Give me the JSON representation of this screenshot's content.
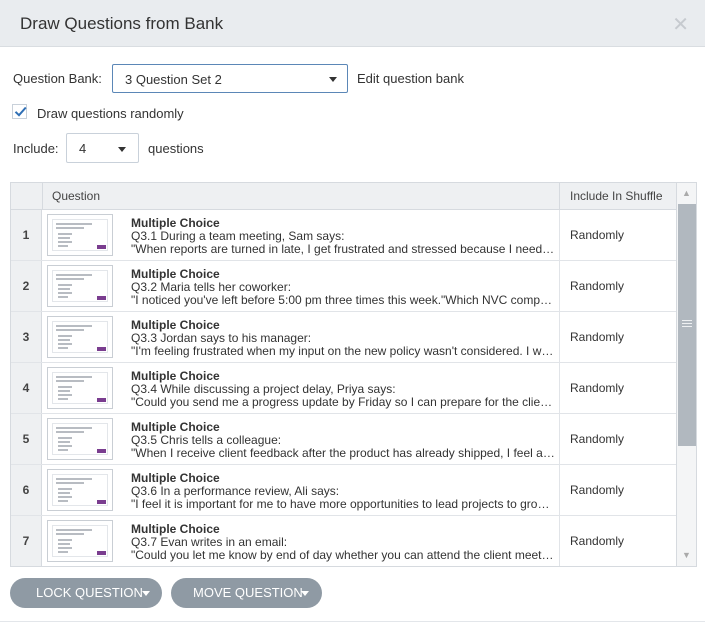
{
  "dialog": {
    "title": "Draw Questions from Bank",
    "close_icon": "close-icon"
  },
  "question_bank": {
    "label": "Question Bank:",
    "selected": "3 Question Set 2",
    "edit_link": "Edit question bank"
  },
  "draw_randomly": {
    "label": "Draw questions randomly",
    "checked": true
  },
  "include": {
    "label": "Include:",
    "value": "4",
    "suffix": "questions"
  },
  "table": {
    "headers": {
      "question": "Question",
      "include_in_shuffle": "Include In Shuffle"
    },
    "rows": [
      {
        "num": "1",
        "type": "Multiple Choice",
        "title": "Q3.1 During a team meeting, Sam says:",
        "snippet": "\"When reports are turned in late, I get frustrated and stressed because I need time to review them thoroughly.\"",
        "shuffle": "Randomly"
      },
      {
        "num": "2",
        "type": "Multiple Choice",
        "title": "Q3.2 Maria tells her coworker:",
        "snippet": "\"I noticed you've left before 5:00 pm three times this week.\"Which NVC component is this?",
        "shuffle": "Randomly"
      },
      {
        "num": "3",
        "type": "Multiple Choice",
        "title": "Q3.3 Jordan says to his manager:",
        "snippet": "\"I'm feeling frustrated when my input on the new policy wasn't considered. I want to be included.\"",
        "shuffle": "Randomly"
      },
      {
        "num": "4",
        "type": "Multiple Choice",
        "title": "Q3.4 While discussing a project delay, Priya says:",
        "snippet": "\"Could you send me a progress update by Friday so I can prepare for the client meeting?\"",
        "shuffle": "Randomly"
      },
      {
        "num": "5",
        "type": "Multiple Choice",
        "title": "Q3.5 Chris tells a colleague:",
        "snippet": "\"When I receive client feedback after the product has already shipped, I feel anxious about it.\"",
        "shuffle": "Randomly"
      },
      {
        "num": "6",
        "type": "Multiple Choice",
        "title": "Q3.6 In a performance review, Ali says:",
        "snippet": "\"I feel it is important for me to have more opportunities to lead projects to grow in my role.\"",
        "shuffle": "Randomly"
      },
      {
        "num": "7",
        "type": "Multiple Choice",
        "title": "Q3.7 Evan writes in an email:",
        "snippet": "\"Could you let me know by end of day whether you can attend the client meeting?\"",
        "shuffle": "Randomly"
      }
    ]
  },
  "scrollbar": {
    "up_icon": "scroll-up-icon",
    "down_icon": "scroll-down-icon"
  },
  "actions": {
    "lock": "LOCK QUESTION",
    "move": "MOVE QUESTION"
  },
  "colors": {
    "accent_border": "#5b87b7",
    "check": "#2f6fb5",
    "pill": "#8f9aa4",
    "header_bg": "#e9ecef",
    "thumb_button": "#7a3d8f"
  }
}
